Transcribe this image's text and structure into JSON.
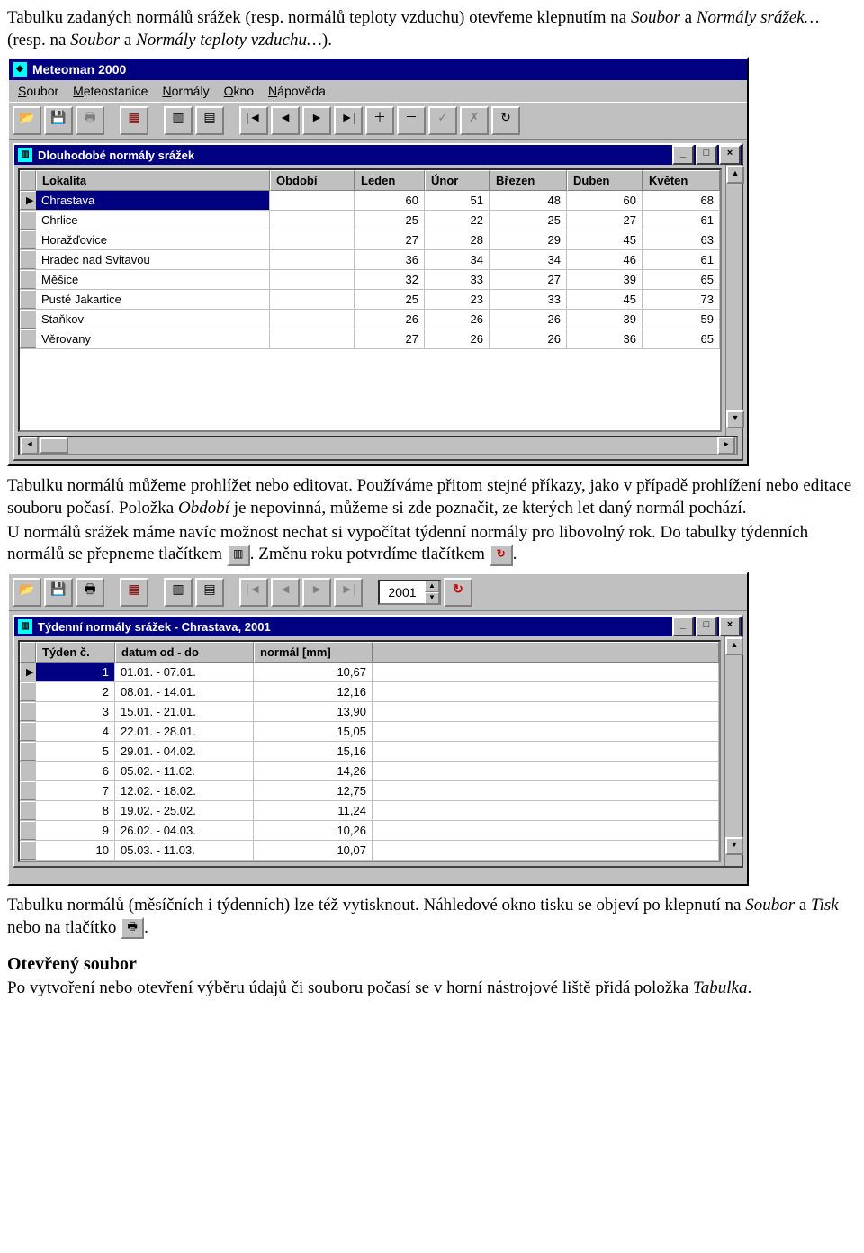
{
  "para1": "Tabulku zadaných normálů srážek (resp. normálů teploty vzduchu) otevřeme klepnutím na ",
  "para1i1": "Soubor",
  "para1m": " a ",
  "para1i2": "Normály srážek…",
  "para1m2": " (resp. na ",
  "para1i3": "Soubor",
  "para1m3": " a ",
  "para1i4": "Normály teploty vzduchu…",
  "para1end": ").",
  "app1": {
    "title": "Meteoman 2000",
    "menu": [
      "Soubor",
      "Meteostanice",
      "Normály",
      "Okno",
      "Nápověda"
    ],
    "sub": "Dlouhodobé normály srážek",
    "head": [
      "Lokalita",
      "Období",
      "Leden",
      "Únor",
      "Březen",
      "Duben",
      "Květen"
    ],
    "rows": [
      {
        "cells": [
          "Chrastava",
          "",
          "60",
          "51",
          "48",
          "60",
          "68"
        ],
        "sel": true,
        "mark": "▶"
      },
      {
        "cells": [
          "Chrlice",
          "",
          "25",
          "22",
          "25",
          "27",
          "61"
        ]
      },
      {
        "cells": [
          "Horažďovice",
          "",
          "27",
          "28",
          "29",
          "45",
          "63"
        ]
      },
      {
        "cells": [
          "Hradec nad Svitavou",
          "",
          "36",
          "34",
          "34",
          "46",
          "61"
        ]
      },
      {
        "cells": [
          "Měšice",
          "",
          "32",
          "33",
          "27",
          "39",
          "65"
        ]
      },
      {
        "cells": [
          "Pusté Jakartice",
          "",
          "25",
          "23",
          "33",
          "45",
          "73"
        ]
      },
      {
        "cells": [
          "Staňkov",
          "",
          "26",
          "26",
          "26",
          "39",
          "59"
        ]
      },
      {
        "cells": [
          "Věrovany",
          "",
          "27",
          "26",
          "26",
          "36",
          "65"
        ]
      }
    ]
  },
  "para2a": "Tabulku normálů můžeme prohlížet nebo editovat. Používáme přitom stejné příkazy, jako v případě prohlížení nebo editace souboru počasí. Položka ",
  "para2i": "Období",
  "para2b": " je nepovinná, můžeme si zde poznačit, ze kterých let daný normál pochází.",
  "para3": "U normálů srážek máme navíc možnost nechat si vypočítat týdenní normály pro libovolný rok. Do tabulky týdenních normálů se přepneme tlačítkem ",
  "para3m": ". Změnu roku potvrdíme tlačítkem ",
  "para3end": ".",
  "app2": {
    "year": "2001",
    "sub": "Týdenní normály srážek - Chrastava, 2001",
    "head": [
      "Týden č.",
      "datum od - do",
      "normál [mm]"
    ],
    "rows": [
      {
        "cells": [
          "1",
          "01.01. - 07.01.",
          "10,67"
        ],
        "sel": true,
        "mark": "▶"
      },
      {
        "cells": [
          "2",
          "08.01. - 14.01.",
          "12,16"
        ]
      },
      {
        "cells": [
          "3",
          "15.01. - 21.01.",
          "13,90"
        ]
      },
      {
        "cells": [
          "4",
          "22.01. - 28.01.",
          "15,05"
        ]
      },
      {
        "cells": [
          "5",
          "29.01. - 04.02.",
          "15,16"
        ]
      },
      {
        "cells": [
          "6",
          "05.02. - 11.02.",
          "14,26"
        ]
      },
      {
        "cells": [
          "7",
          "12.02. - 18.02.",
          "12,75"
        ]
      },
      {
        "cells": [
          "8",
          "19.02. - 25.02.",
          "11,24"
        ]
      },
      {
        "cells": [
          "9",
          "26.02. - 04.03.",
          "10,26"
        ]
      },
      {
        "cells": [
          "10",
          "05.03. - 11.03.",
          "10,07"
        ]
      }
    ]
  },
  "para4a": "Tabulku normálů (měsíčních i týdenních) lze též vytisknout. Náhledové okno tisku se objeví po klepnutí na ",
  "para4i1": "Soubor",
  "para4m": " a ",
  "para4i2": "Tisk",
  "para4b": " nebo na tlačítko ",
  "para4end": ".",
  "heading": "Otevřený soubor",
  "para5a": "Po vytvoření nebo otevření výběru údajů či souboru počasí se v horní nástrojové liště přidá položka ",
  "para5i": "Tabulka",
  "para5end": "."
}
